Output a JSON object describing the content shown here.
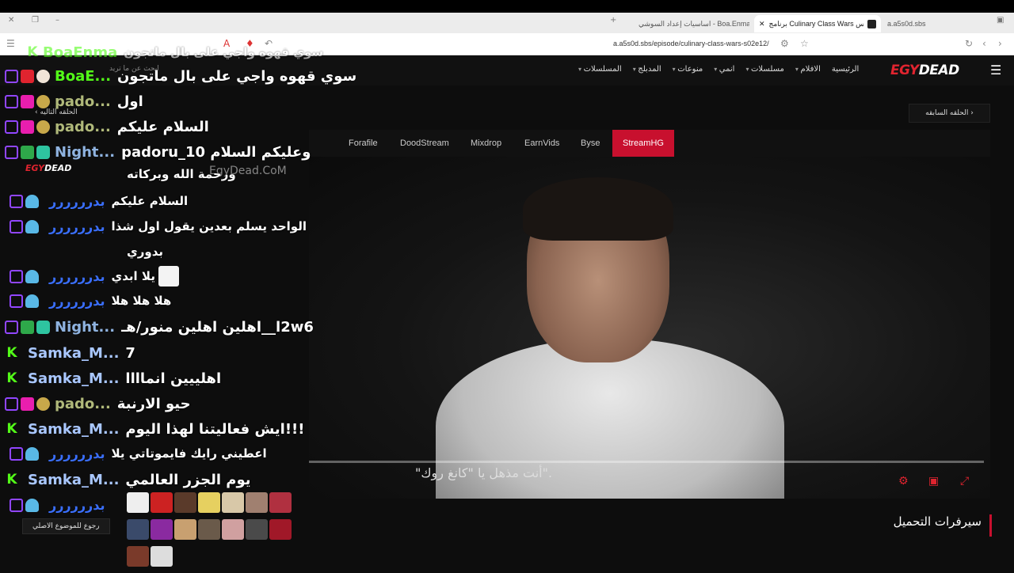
{
  "browser": {
    "tabs": [
      {
        "label": "a.a5s0d.sbs"
      },
      {
        "label": "برنامج Culinary Class Wars الموس..."
      },
      {
        "label": "اساسيات إعداد السوشي - Boa.Enma"
      }
    ],
    "url": "a.a5s0d.sbs/episode/culinary-class-wars-s02e12/"
  },
  "site": {
    "logo_part1": "EGY",
    "logo_part2": "DEAD",
    "menu": [
      "الرئيسية",
      "الافلام",
      "مسلسلات",
      "انمي",
      "منوعات",
      "المدبلج",
      "المسلسلات"
    ],
    "prev_episode": "الحلقه السابقه",
    "next_episode": "الحلقه التاليه",
    "servers": [
      "Forafile",
      "DoodStream",
      "Mixdrop",
      "EarnVids",
      "Byse",
      "StreamHG"
    ],
    "active_server": "StreamHG",
    "subtitle": "\"أنت مذهل يا \"كانغ روك\".",
    "downloads_heading": "سيرفرات التحميل",
    "back_to_topic": "رجوع للموضوع الاصلي",
    "watermark": "EgyDead.CoM",
    "search_hint": "ابحث عن ما تريد"
  },
  "chat": {
    "messages": [
      {
        "platform": "kick",
        "user": "BoaEnma",
        "color": "#53fc18",
        "text": "سوي قهوه واجي على بال ماتجون"
      },
      {
        "platform": "twitch",
        "user": "BoaE...",
        "color": "#53fc18",
        "text": "سوي قهوه واجي على بال ماتجون"
      },
      {
        "platform": "twitch",
        "user": "pado...",
        "color": "#b0b97a",
        "text": "اول"
      },
      {
        "platform": "twitch",
        "user": "pado...",
        "color": "#b0b97a",
        "text": "السلام عليكم"
      },
      {
        "platform": "twitch",
        "user": "Night...",
        "color": "#8fb3e0",
        "text": "padoru_10 وعليكم السلام"
      },
      {
        "platform": "twitch",
        "user": "",
        "color": "#8fb3e0",
        "text": "ورحمة الله وبركاته"
      },
      {
        "platform": "twitch",
        "user": "بدرررررر",
        "color": "#3a6fff",
        "text": "السلام عليكم"
      },
      {
        "platform": "twitch",
        "user": "بدرررررر",
        "color": "#3a6fff",
        "text": "الواحد يسلم بعدين يقول اول شذا"
      },
      {
        "platform": "twitch",
        "user": "",
        "color": "#3a6fff",
        "text": "بدوري"
      },
      {
        "platform": "twitch",
        "user": "بدرررررر",
        "color": "#3a6fff",
        "text": "يلا ابدي"
      },
      {
        "platform": "twitch",
        "user": "بدرررررر",
        "color": "#3a6fff",
        "text": "هلا هلا هلا"
      },
      {
        "platform": "twitch",
        "user": "Night...",
        "color": "#8fb3e0",
        "text": "اهلين اهلين منور/هـ__l2w6"
      },
      {
        "platform": "kick",
        "user": "Samka_M...",
        "color": "#a9c7ff",
        "text": "7"
      },
      {
        "platform": "kick",
        "user": "Samka_M...",
        "color": "#a9c7ff",
        "text": "اهلييين انماااا"
      },
      {
        "platform": "twitch",
        "user": "pado...",
        "color": "#b0b97a",
        "text": "حيو الارنبة"
      },
      {
        "platform": "kick",
        "user": "Samka_M...",
        "color": "#a9c7ff",
        "text": "ايش فعاليتنا لهذا اليوم!!!"
      },
      {
        "platform": "twitch",
        "user": "بدرررررر",
        "color": "#3a6fff",
        "text": "اعطيني رايك فايموتاتي يلا"
      },
      {
        "platform": "kick",
        "user": "Samka_M...",
        "color": "#a9c7ff",
        "text": "يوم الجزر العالمي"
      },
      {
        "platform": "twitch",
        "user": "بدرررررر",
        "color": "#3a6fff",
        "text": ""
      }
    ]
  }
}
